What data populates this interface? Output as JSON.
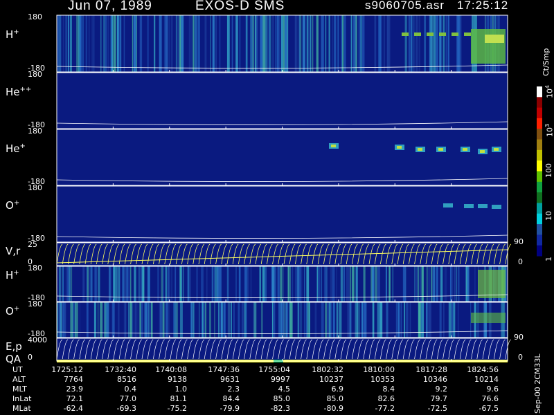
{
  "header": {
    "date": "Jun 07, 1989",
    "instrument": "EXOS-D SMS",
    "file": "s9060705.asr",
    "time": "17:25:12"
  },
  "side_label": "Sep-00 2CM33L",
  "colorbar": {
    "unit": "Ct/Smp",
    "ticks": [
      {
        "text": "10",
        "sup": "4",
        "value": 10000
      },
      {
        "text": "10",
        "sup": "3",
        "value": 1000
      },
      {
        "text": "100",
        "sup": "",
        "value": 100
      },
      {
        "text": "10",
        "sup": "",
        "value": 10
      },
      {
        "text": "1",
        "sup": "",
        "value": 1
      }
    ],
    "colors": [
      "#ffffff",
      "#8b0000",
      "#c00000",
      "#ff2000",
      "#805010",
      "#a08010",
      "#c0c000",
      "#ffff00",
      "#60c000",
      "#10a040",
      "#107020",
      "#00a0a0",
      "#00d0e0",
      "#2050a0",
      "#1028a0",
      "#000080"
    ]
  },
  "panels": [
    {
      "id": "hplus-1",
      "name": "H",
      "sup": "+",
      "ymax": "180",
      "ymin": "-180"
    },
    {
      "id": "heplusplus",
      "name": "He",
      "sup": "++",
      "ymax": "180",
      "ymin": "-180"
    },
    {
      "id": "heplus",
      "name": "He",
      "sup": "+",
      "ymax": "180",
      "ymin": "-180"
    },
    {
      "id": "oplus-1",
      "name": "O",
      "sup": "+",
      "ymax": "180",
      "ymin": "-180"
    },
    {
      "id": "vr",
      "name": "V,r",
      "sup": "",
      "ymax": "25",
      "ymin": "0",
      "right_top": "90",
      "right_bottom": "0"
    },
    {
      "id": "hplus-2",
      "name": "H",
      "sup": "+",
      "ymax": "180",
      "ymin": "-180"
    },
    {
      "id": "oplus-2",
      "name": "O",
      "sup": "+",
      "ymax": "180",
      "ymin": "-180"
    },
    {
      "id": "ep",
      "name": "E,p",
      "name2": "QA",
      "sup": "",
      "ymax": "4000",
      "ymin": "0",
      "right_top": "90",
      "right_bottom": "0"
    }
  ],
  "footer": {
    "row_labels": [
      "UT",
      "ALT",
      "MLT",
      "InLat",
      "MLat"
    ],
    "columns": [
      {
        "UT": "1725:12",
        "ALT": "7764",
        "MLT": "23.9",
        "InLat": "72.1",
        "MLat": "-62.4"
      },
      {
        "UT": "1732:40",
        "ALT": "8516",
        "MLT": "0.4",
        "InLat": "77.0",
        "MLat": "-69.3"
      },
      {
        "UT": "1740:08",
        "ALT": "9138",
        "MLT": "1.0",
        "InLat": "81.1",
        "MLat": "-75.2"
      },
      {
        "UT": "1747:36",
        "ALT": "9631",
        "MLT": "2.3",
        "InLat": "84.4",
        "MLat": "-79.9"
      },
      {
        "UT": "1755:04",
        "ALT": "9997",
        "MLT": "4.5",
        "InLat": "85.0",
        "MLat": "-82.3"
      },
      {
        "UT": "1802:32",
        "ALT": "10237",
        "MLT": "6.9",
        "InLat": "85.0",
        "MLat": "-80.9"
      },
      {
        "UT": "1810:00",
        "ALT": "10353",
        "MLT": "8.4",
        "InLat": "82.6",
        "MLat": "-77.2"
      },
      {
        "UT": "1817:28",
        "ALT": "10346",
        "MLT": "9.2",
        "InLat": "79.7",
        "MLat": "-72.5"
      },
      {
        "UT": "1824:56",
        "ALT": "10214",
        "MLT": "9.6",
        "InLat": "76.6",
        "MLat": "-67.5"
      }
    ]
  },
  "chart_data": {
    "type": "heatmap",
    "title": "Jun 07, 1989   EXOS-D SMS",
    "x_ticks_ut": [
      "1725:12",
      "1732:40",
      "1740:08",
      "1747:36",
      "1755:04",
      "1802:32",
      "1810:00",
      "1817:28",
      "1824:56"
    ],
    "colorbar_scale": "log",
    "colorbar_range": [
      1,
      10000
    ],
    "series": [
      {
        "name": "H+",
        "ylim": [
          -180,
          180
        ]
      },
      {
        "name": "He++",
        "ylim": [
          -180,
          180
        ]
      },
      {
        "name": "He+",
        "ylim": [
          -180,
          180
        ]
      },
      {
        "name": "O+",
        "ylim": [
          -180,
          180
        ]
      },
      {
        "name": "V,r",
        "ylim": [
          0,
          25
        ]
      },
      {
        "name": "H+",
        "ylim": [
          -180,
          180
        ]
      },
      {
        "name": "O+",
        "ylim": [
          -180,
          180
        ]
      },
      {
        "name": "E,p",
        "ylim": [
          0,
          4000
        ]
      }
    ]
  }
}
